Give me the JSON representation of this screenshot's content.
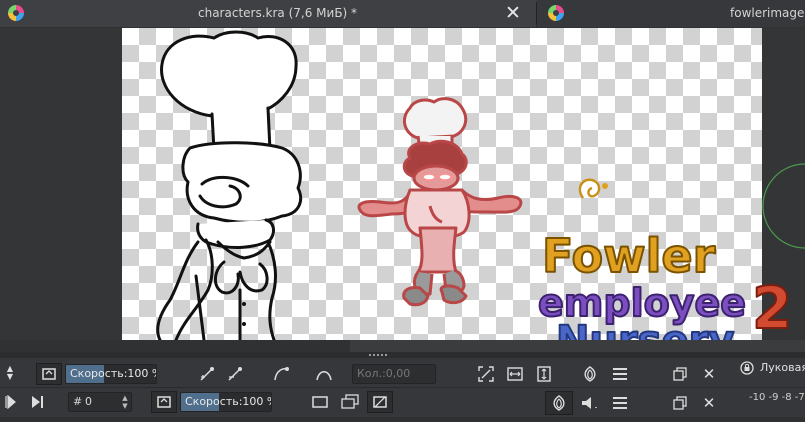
{
  "tabs": [
    {
      "title": "characters.kra (7,6 МиБ) *",
      "active": true
    },
    {
      "title": "fowlerimage.p",
      "active": false
    }
  ],
  "canvas": {
    "logo_lines": [
      "Fowler",
      "employee",
      "Nursery",
      "2"
    ]
  },
  "bottom_toolbar": {
    "row1": {
      "speed_label": "Скорость:",
      "speed_value": "100 %",
      "speed_fill": 0.42,
      "count_placeholder": "Кол.:0,00"
    },
    "row2": {
      "frame_hash": "#",
      "frame_value": "0",
      "speed_label": "Скорость:",
      "speed_value": "100 %",
      "speed_fill": 0.42
    },
    "right_panel": {
      "lock_label": "Луковая",
      "ruler_values": "-10 -9 -8 -7"
    }
  },
  "colors": {
    "accent": "#4f6f8d",
    "title_gold": "#e0a020",
    "title_purple": "#7b4fc0",
    "title_blue": "#4a66c8",
    "title_red": "#d24a2f"
  }
}
